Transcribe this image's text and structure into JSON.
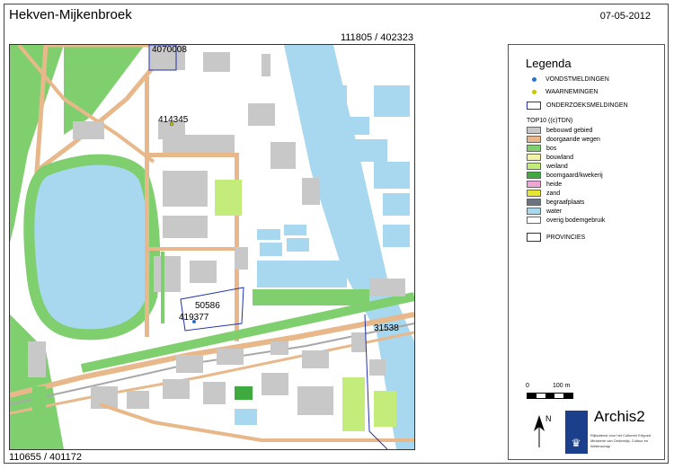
{
  "header": {
    "title": "Hekven-Mijkenbroek",
    "date": "07-05-2012"
  },
  "map": {
    "coord_top_right": "111805 / 402323",
    "coord_bottom_left": "110655 / 401172",
    "labels": [
      "4070008",
      "414345",
      "50586",
      "419377",
      "31538"
    ]
  },
  "legend": {
    "title": "Legenda",
    "symbols": [
      {
        "label": "VONDSTMELDINGEN",
        "color": "#2e6fd0"
      },
      {
        "label": "WAARNEMINGEN",
        "color": "#c8c800"
      },
      {
        "label": "ONDERZOEKSMELDINGEN",
        "color": "#2233aa"
      }
    ],
    "top10_title": "TOP10 ((c)TDN)",
    "classes": [
      {
        "label": "bebouwd gebied",
        "color": "#c8c8c8"
      },
      {
        "label": "doorgaande wegen",
        "color": "#e8b88a"
      },
      {
        "label": "bos",
        "color": "#7fcf6f"
      },
      {
        "label": "bouwland",
        "color": "#f3f3a8"
      },
      {
        "label": "weiland",
        "color": "#c3ec7a"
      },
      {
        "label": "boomgaard/kwekerij",
        "color": "#3faa3f"
      },
      {
        "label": "heide",
        "color": "#f0a6d4"
      },
      {
        "label": "zand",
        "color": "#e6e62e"
      },
      {
        "label": "begraafplaats",
        "color": "#6d7480"
      },
      {
        "label": "water",
        "color": "#a8d8f0"
      },
      {
        "label": "overig bodemgebruik",
        "color": "#ffffff"
      }
    ],
    "provincies": "PROVINCIES"
  },
  "scale": {
    "zero": "0",
    "max": "100 m"
  },
  "north": {
    "label": "N"
  },
  "branding": {
    "name": "Archis2",
    "subtitle": "Rijksdienst voor het Cultureel Erfgoed Ministerie van Onderwijs, Cultuur en Wetenschap"
  }
}
